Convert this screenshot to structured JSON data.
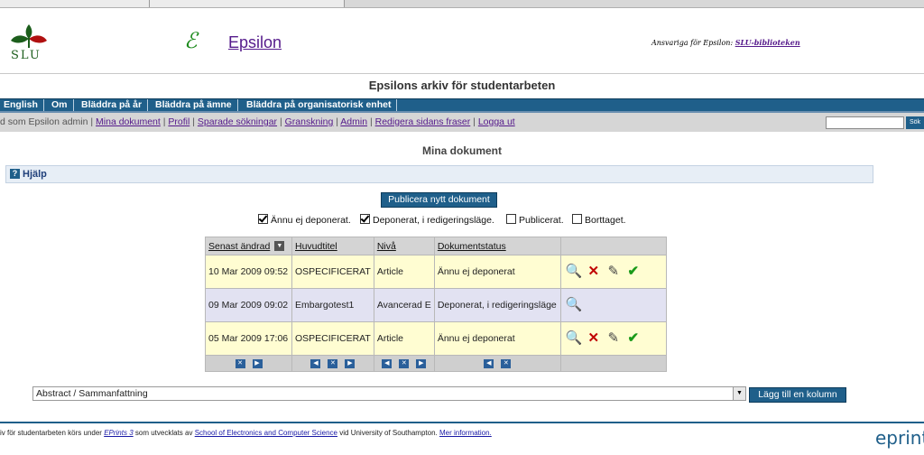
{
  "header": {
    "slu_text": "SLU",
    "epsilon_logo": "ℰ",
    "epsilon_link": "Epsilon",
    "responsible_label": "Ansvariga för Epsilon:",
    "responsible_link": "SLU-biblioteken"
  },
  "archive_title": "Epsilons arkiv för studentarbeten",
  "nav": {
    "items": [
      "English",
      "Om",
      "Bläddra på år",
      "Bläddra på ämne",
      "Bläddra på organisatorisk enhet"
    ]
  },
  "userbar": {
    "prefix": "d som Epsilon admin |",
    "links": [
      "Mina dokument",
      "Profil",
      "Sparade sökningar",
      "Granskning",
      "Admin",
      "Redigera sidans fraser",
      "Logga ut"
    ],
    "search_button": "Sök"
  },
  "page_heading": "Mina dokument",
  "help": {
    "label": "Hjälp"
  },
  "publish_button": "Publicera nytt dokument",
  "filters": [
    {
      "label": "Ännu ej deponerat.",
      "checked": true
    },
    {
      "label": "Deponerat, i redigeringsläge.",
      "checked": true
    },
    {
      "label": "Publicerat.",
      "checked": false
    },
    {
      "label": "Borttaget.",
      "checked": false
    }
  ],
  "table": {
    "columns": [
      "Senast ändrad",
      "Huvudtitel",
      "Nivå",
      "Dokumentstatus"
    ],
    "rows": [
      {
        "date": "10 Mar 2009 09:52",
        "title": "OSPECIFICERAT",
        "level": "Article",
        "status": "Ännu ej deponerat",
        "actions": [
          "view-icon",
          "delete-icon",
          "edit-icon",
          "deposit-icon"
        ],
        "color": "yellow"
      },
      {
        "date": "09 Mar 2009 09:02",
        "title": "Embargotest1",
        "level": "Avancerad E",
        "status": "Deponerat, i redigeringsläge",
        "actions": [
          "view-icon"
        ],
        "color": "lilac"
      },
      {
        "date": "05 Mar 2009 17:06",
        "title": "OSPECIFICERAT",
        "level": "Article",
        "status": "Ännu ej deponerat",
        "actions": [
          "view-icon",
          "delete-icon",
          "edit-icon",
          "deposit-icon"
        ],
        "color": "yellow"
      }
    ]
  },
  "column_selector": {
    "value": "Abstract / Sammanfattning",
    "add_button": "Lägg till en kolumn"
  },
  "footer": {
    "text1": "iv för studentarbeten körs under",
    "eprints_link": "EPrints 3",
    "text2": "som utvecklats av",
    "school_link": "School of Electronics and Computer Science",
    "text3": "vid University of Southampton.",
    "more_link": "Mer information.",
    "eprints_logo": "eprint"
  },
  "colors": {
    "nav_blue": "#1f5f8a",
    "row_yellow": "#fffdd2",
    "row_lilac": "#e2e2f2",
    "header_gray": "#d4d4d4"
  }
}
